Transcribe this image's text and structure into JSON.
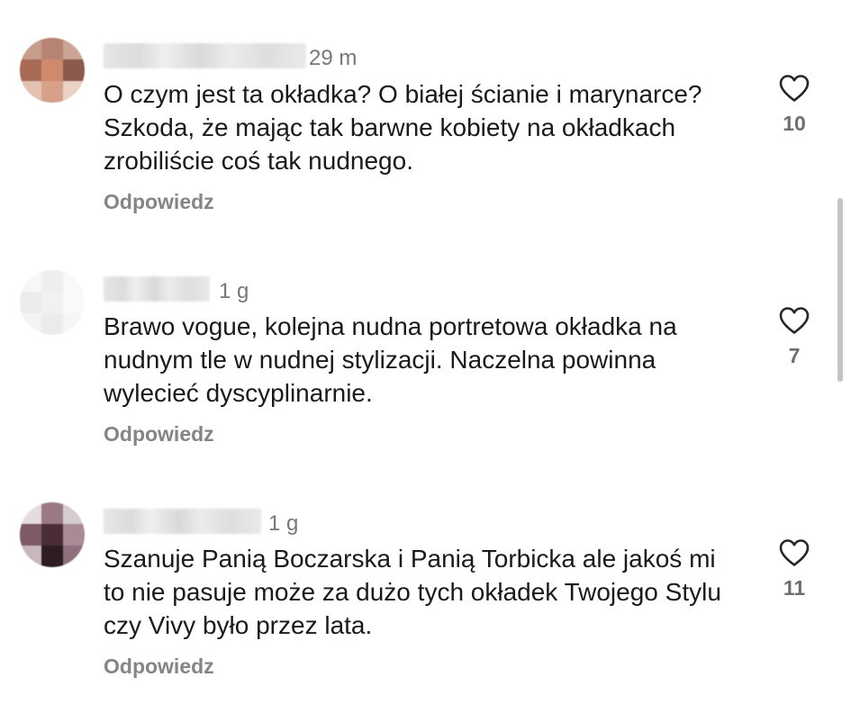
{
  "comments": [
    {
      "time": "29 m",
      "text": "O czym jest ta okładka? O białej ścianie i marynarce? Szkoda, że mając tak barwne kobiety na okładkach zrobiliście coś tak nudnego.",
      "reply_label": "Odpowiedz",
      "likes": "10"
    },
    {
      "time": "1 g",
      "text": "Brawo vogue, kolejna nudna portretowa okładka na nudnym tle w nudnej stylizacji. Naczelna powinna wylecieć dyscyplinarnie.",
      "reply_label": "Odpowiedz",
      "likes": "7"
    },
    {
      "time": "1 g",
      "text": "Szanuje Panią Boczarska i Panią Torbicka ale jakoś mi to nie pasuje może za dużo tych okładek Twojego Stylu czy Vivy było przez lata.",
      "reply_label": "Odpowiedz",
      "likes": "11"
    }
  ],
  "icons": {
    "like": "heart-outline-icon"
  },
  "colors": {
    "text": "#1a1a1a",
    "secondary": "#858585",
    "icon": "#262626"
  }
}
